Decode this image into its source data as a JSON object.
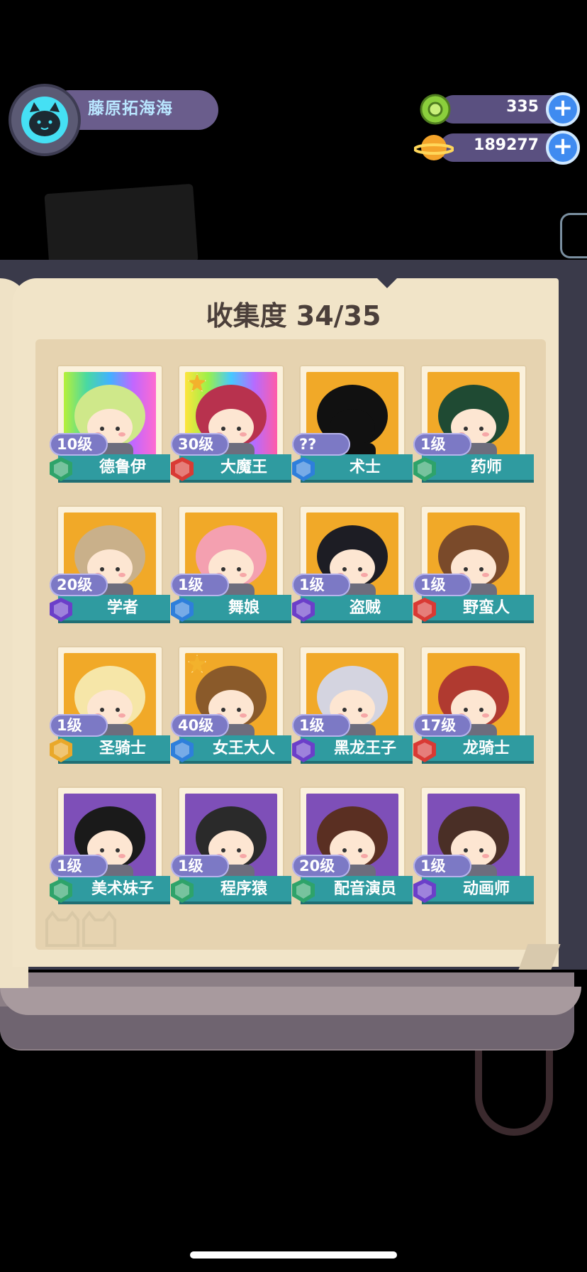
{
  "player": {
    "name": "藤原拓海海",
    "avatar_icon": "cat-face-icon"
  },
  "currencies": [
    {
      "icon": "green-gem-coin-icon",
      "value": "335",
      "plus_icon": "plus-icon"
    },
    {
      "icon": "gold-planet-coin-icon",
      "value": "189277",
      "plus_icon": "plus-icon"
    }
  ],
  "collection": {
    "title": "收集度 34/35"
  },
  "role_colors": {
    "green": "#2ea36a",
    "red": "#d93a34",
    "blue": "#2e7fdb",
    "purple": "#6b3fc9",
    "gold": "#e9a82a"
  },
  "characters": [
    {
      "name": "德鲁伊",
      "level": "10级",
      "role": "green",
      "bg": "rainbow",
      "star": false
    },
    {
      "name": "大魔王",
      "level": "30级",
      "role": "red",
      "bg": "rainbow2",
      "star": true
    },
    {
      "name": "术士",
      "level": "??",
      "role": "blue",
      "bg": "gold",
      "star": false,
      "locked": true
    },
    {
      "name": "药师",
      "level": "1级",
      "role": "green",
      "bg": "gold",
      "star": false
    },
    {
      "name": "学者",
      "level": "20级",
      "role": "purple",
      "bg": "gold",
      "star": false
    },
    {
      "name": "舞娘",
      "level": "1级",
      "role": "blue",
      "bg": "gold",
      "star": false
    },
    {
      "name": "盗贼",
      "level": "1级",
      "role": "purple",
      "bg": "gold",
      "star": false
    },
    {
      "name": "野蛮人",
      "level": "1级",
      "role": "red",
      "bg": "gold",
      "star": false
    },
    {
      "name": "圣骑士",
      "level": "1级",
      "role": "gold",
      "bg": "gold",
      "star": false
    },
    {
      "name": "女王大人",
      "level": "40级",
      "role": "blue",
      "bg": "gold",
      "star": true
    },
    {
      "name": "黑龙王子",
      "level": "1级",
      "role": "purple",
      "bg": "gold",
      "star": false
    },
    {
      "name": "龙骑士",
      "level": "17级",
      "role": "red",
      "bg": "gold",
      "star": false
    },
    {
      "name": "美术妹子",
      "level": "1级",
      "role": "green",
      "bg": "purple",
      "star": false
    },
    {
      "name": "程序猿",
      "level": "1级",
      "role": "green",
      "bg": "purple",
      "star": false
    },
    {
      "name": "配音演员",
      "level": "20级",
      "role": "green",
      "bg": "purple",
      "star": false
    },
    {
      "name": "动画师",
      "level": "1级",
      "role": "purple",
      "bg": "purple",
      "star": false
    }
  ]
}
